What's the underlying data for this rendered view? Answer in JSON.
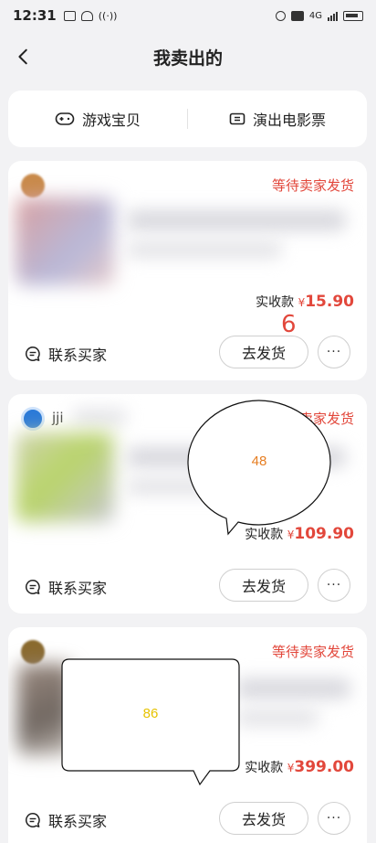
{
  "status_bar": {
    "time": "12:31",
    "network": "4G"
  },
  "header": {
    "title": "我卖出的"
  },
  "tabs": [
    {
      "label": "游戏宝贝",
      "icon": "gamepad-icon"
    },
    {
      "label": "演出电影票",
      "icon": "ticket-icon"
    }
  ],
  "orders": [
    {
      "status": "等待卖家发货",
      "buyer_name": "",
      "price_label": "实收款",
      "currency": "¥",
      "price": "15.90",
      "contact_label": "联系买家",
      "ship_label": "去发货",
      "more_label": "···"
    },
    {
      "status": "等待卖家发货",
      "buyer_name": "jji",
      "price_label": "实收款",
      "currency": "¥",
      "price": "109.90",
      "contact_label": "联系买家",
      "ship_label": "去发货",
      "more_label": "···"
    },
    {
      "status": "等待卖家发货",
      "buyer_name": "",
      "price_label": "实收款",
      "currency": "¥",
      "price": "399.00",
      "contact_label": "联系买家",
      "ship_label": "去发货",
      "more_label": "···"
    }
  ],
  "annotations": {
    "number_label": "6",
    "oval_bubble": "48",
    "rect_bubble": "86"
  }
}
